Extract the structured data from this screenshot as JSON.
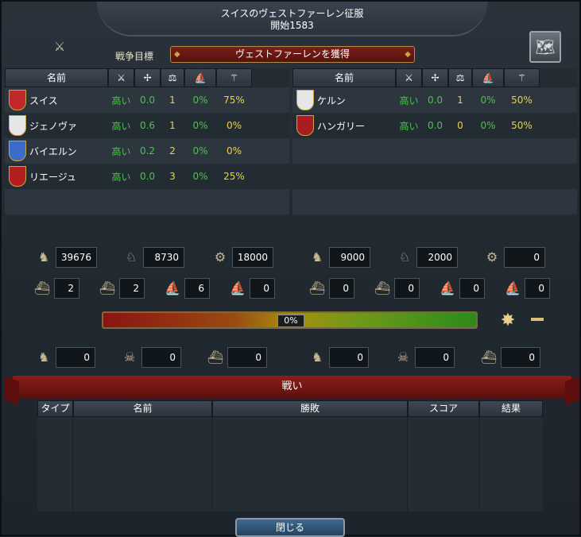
{
  "header": {
    "title": "スイスのヴェストファーレン征服",
    "subtitle": "開始1583"
  },
  "goal": {
    "label": "戦争目標",
    "value": "ヴェストファーレンを獲得"
  },
  "table_headers": {
    "name": "名前"
  },
  "attackers": [
    {
      "name": "スイス",
      "col1": "高い",
      "col2": "0.0",
      "col3": "1",
      "col4": "0%",
      "col5": "75%",
      "flag_color": "#c0282a",
      "leader": true
    },
    {
      "name": "ジェノヴァ",
      "col1": "高い",
      "col2": "0.6",
      "col3": "1",
      "col4": "0%",
      "col5": "0%",
      "flag_color": "#e6e6e6"
    },
    {
      "name": "バイエルン",
      "col1": "高い",
      "col2": "0.2",
      "col3": "2",
      "col4": "0%",
      "col5": "0%",
      "flag_color": "#3a6cc8"
    },
    {
      "name": "リエージュ",
      "col1": "高い",
      "col2": "0.0",
      "col3": "3",
      "col4": "0%",
      "col5": "25%",
      "flag_color": "#b41e1e"
    }
  ],
  "defenders": [
    {
      "name": "ケルン",
      "col1": "高い",
      "col2": "0.0",
      "col3": "1",
      "col4": "0%",
      "col5": "50%",
      "flag_color": "#e6e6e6",
      "leader": true
    },
    {
      "name": "ハンガリー",
      "col1": "高い",
      "col2": "0.0",
      "col3": "0",
      "col4": "0%",
      "col5": "50%",
      "flag_color": "#a81e1e"
    }
  ],
  "attacker_units": {
    "infantry": "39676",
    "cavalry": "8730",
    "artillery": "18000",
    "heavy_ships": "2",
    "light_ships": "2",
    "galleys": "6",
    "transports": "0"
  },
  "defender_units": {
    "infantry": "9000",
    "cavalry": "2000",
    "artillery": "0",
    "heavy_ships": "0",
    "light_ships": "0",
    "galleys": "0",
    "transports": "0"
  },
  "war_score": "0%",
  "attacker_losses": {
    "land": "0",
    "attrition": "0",
    "ships": "0"
  },
  "defender_losses": {
    "land": "0",
    "attrition": "0",
    "ships": "0"
  },
  "battles": {
    "title": "戦い",
    "headers": [
      "タイプ",
      "名前",
      "勝敗",
      "スコア",
      "結果"
    ]
  },
  "close_label": "閉じる"
}
